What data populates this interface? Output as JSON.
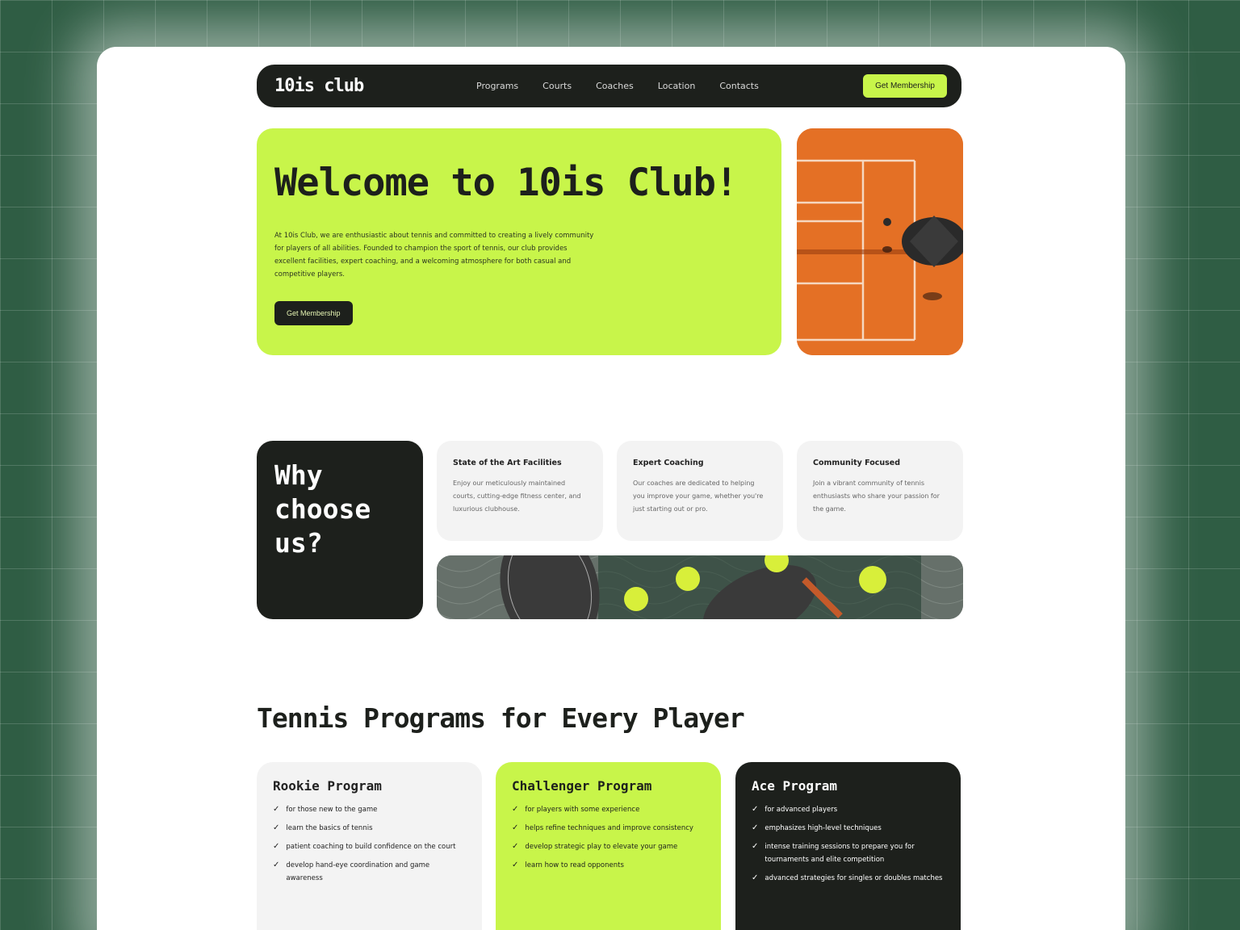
{
  "nav": {
    "logo": "10is club",
    "links": [
      "Programs",
      "Courts",
      "Coaches",
      "Location",
      "Contacts"
    ],
    "cta": "Get Membership"
  },
  "hero": {
    "title": "Welcome to 10is Club!",
    "text": "At 10is Club, we are enthusiastic about tennis and committed to creating a lively community for players of all abilities. Founded to champion the sport of tennis, our club provides excellent facilities, expert coaching, and a welcoming atmosphere for both casual and competitive players.",
    "cta": "Get Membership"
  },
  "why": {
    "title": "Why choose us?",
    "features": [
      {
        "title": "State of the Art Facilities",
        "text": "Enjoy our meticulously maintained courts, cutting-edge fitness center, and luxurious clubhouse."
      },
      {
        "title": "Expert Coaching",
        "text": "Our coaches are dedicated to helping you improve your game, whether you're just starting out or pro."
      },
      {
        "title": "Community Focused",
        "text": "Join a vibrant community of tennis enthusiasts who share your passion for the game."
      }
    ]
  },
  "programs": {
    "title": "Tennis Programs for Every Player",
    "items": [
      {
        "name": "Rookie Program",
        "points": [
          "for those new to the game",
          "learn the basics of tennis",
          "patient coaching to build confidence on the court",
          "develop hand-eye coordination and game awareness"
        ]
      },
      {
        "name": "Challenger Program",
        "points": [
          "for players with some experience",
          "helps refine techniques and improve consistency",
          "develop strategic play to elevate your game",
          "learn how to read opponents"
        ]
      },
      {
        "name": "Ace Program",
        "points": [
          "for advanced players",
          "emphasizes high-level techniques",
          "intense training sessions to prepare you for tournaments and elite competition",
          "advanced strategies for singles or doubles matches"
        ]
      }
    ]
  },
  "colors": {
    "accent": "#c8f54a",
    "dark": "#1d201c",
    "court": "#e77328",
    "background": "#2f5d44"
  }
}
